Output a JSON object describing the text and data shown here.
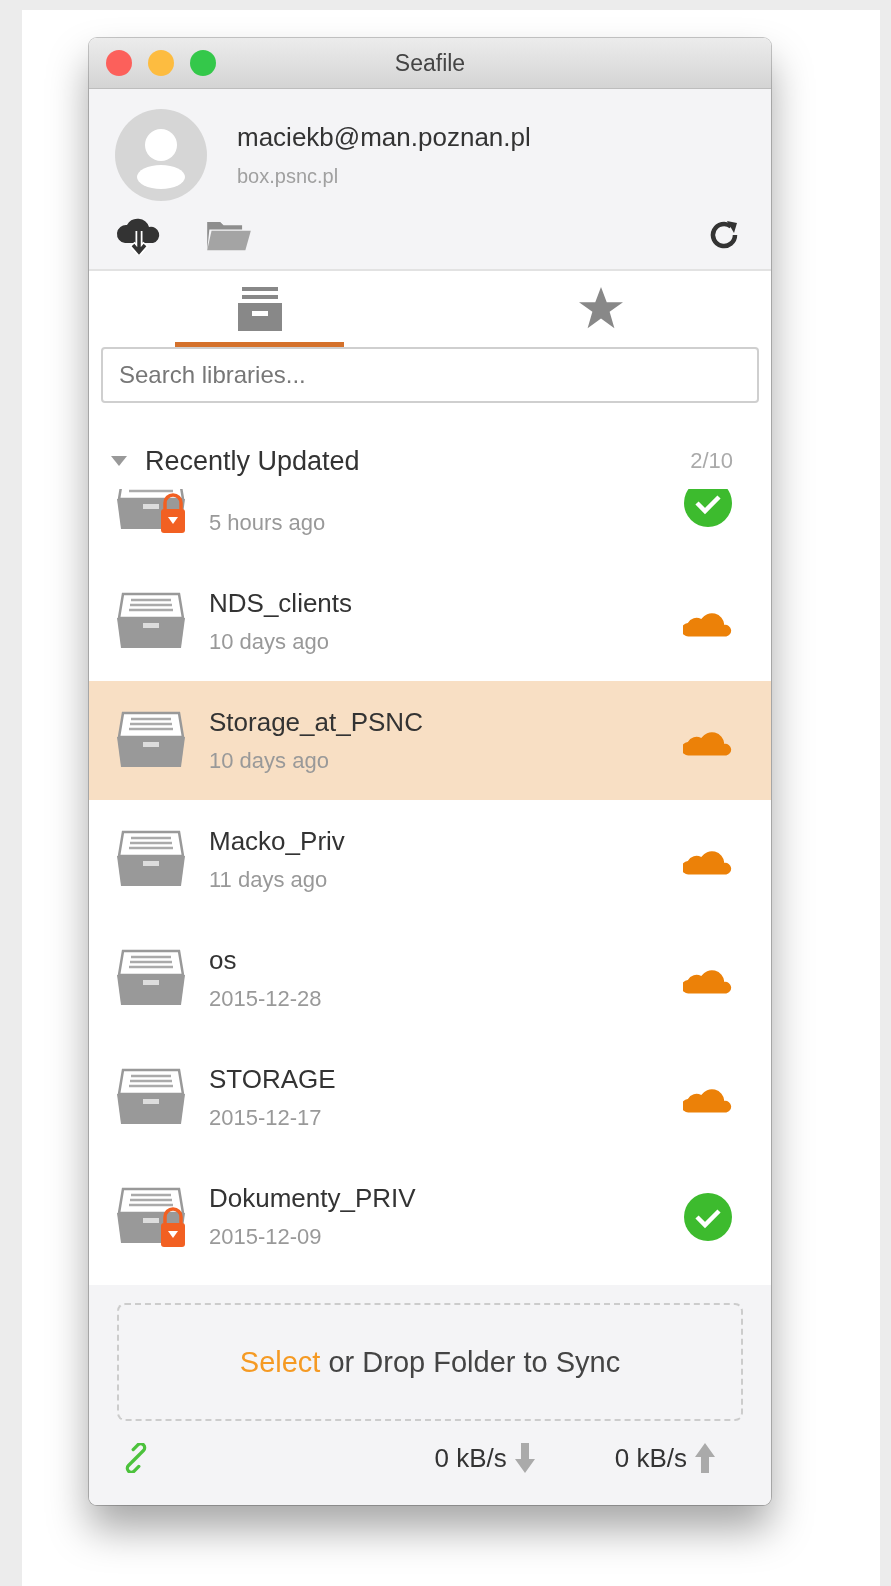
{
  "window": {
    "title": "Seafile"
  },
  "account": {
    "email": "maciekb@man.poznan.pl",
    "server": "box.psnc.pl"
  },
  "tabs": [
    {
      "kind": "libraries",
      "selected": true
    },
    {
      "kind": "starred",
      "selected": false
    }
  ],
  "search": {
    "placeholder": "Search libraries..."
  },
  "section": {
    "title": "Recently Updated",
    "expanded": true,
    "count": "2/10"
  },
  "libraries": [
    {
      "time": "5 hours ago",
      "locked": true,
      "kind": "synced",
      "selected": false
    },
    {
      "name": "NDS_clients",
      "time": "10 days ago",
      "locked": false,
      "kind": "cloud",
      "selected": false
    },
    {
      "name": "Storage_at_PSNC",
      "time": "10 days ago",
      "locked": false,
      "kind": "cloud",
      "selected": true
    },
    {
      "name": "Macko_Priv",
      "time": "11 days ago",
      "locked": false,
      "kind": "cloud",
      "selected": false
    },
    {
      "name": "os",
      "time": "2015-12-28",
      "locked": false,
      "kind": "cloud",
      "selected": false
    },
    {
      "name": "STORAGE",
      "time": "2015-12-17",
      "locked": false,
      "kind": "cloud",
      "selected": false
    },
    {
      "name": "Dokumenty_PRIV",
      "time": "2015-12-09",
      "locked": true,
      "kind": "synced",
      "selected": false
    }
  ],
  "drop_zone": {
    "link": "Select",
    "text": "or Drop Folder to Sync"
  },
  "status_bar": {
    "download": "0 kB/s",
    "upload": "0 kB/s"
  }
}
